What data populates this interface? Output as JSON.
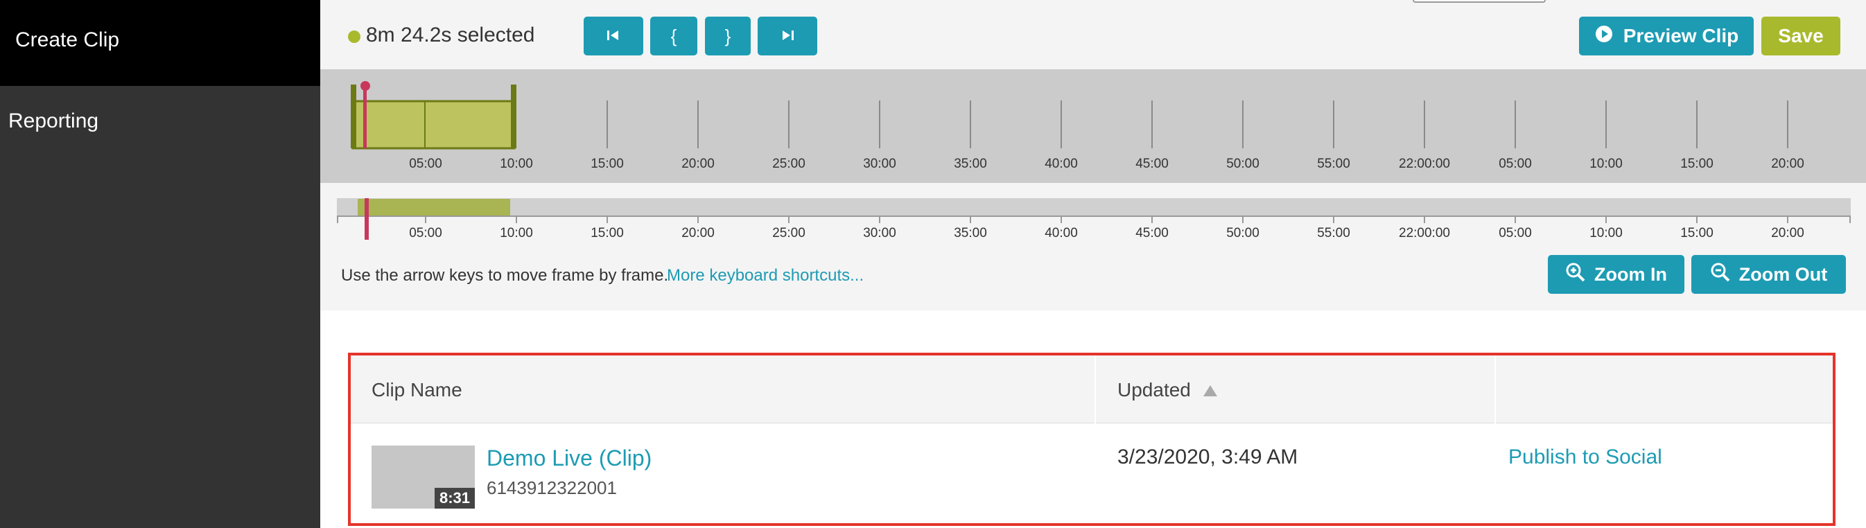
{
  "sidebar": {
    "items": [
      {
        "label": "Create Clip",
        "active": true
      },
      {
        "label": "Reporting",
        "active": false
      }
    ]
  },
  "toolbar": {
    "selection_text": "8m 24.2s selected",
    "buttons": [
      {
        "icon": "skip-to-start-icon",
        "glyph": "⏮"
      },
      {
        "icon": "set-in-point-icon",
        "glyph": "{"
      },
      {
        "icon": "set-out-point-icon",
        "glyph": "}"
      },
      {
        "icon": "skip-to-end-icon",
        "glyph": "⏭"
      }
    ],
    "preview_label": "Preview Clip",
    "save_label": "Save"
  },
  "timeline": {
    "tick_labels": [
      "05:00",
      "10:00",
      "15:00",
      "20:00",
      "25:00",
      "30:00",
      "35:00",
      "40:00",
      "45:00",
      "50:00",
      "55:00",
      "22:00:00",
      "05:00",
      "10:00",
      "15:00",
      "20:00"
    ]
  },
  "hint": {
    "text": "Use the arrow keys to move frame by frame.",
    "link": "More keyboard shortcuts..."
  },
  "zoom": {
    "in_label": "Zoom In",
    "out_label": "Zoom Out"
  },
  "table": {
    "columns": [
      "Clip Name",
      "Updated",
      ""
    ],
    "sort_column": "Updated",
    "rows": [
      {
        "name": "Demo Live (Clip)",
        "id": "6143912322001",
        "duration": "8:31",
        "updated": "3/23/2020, 3:49 AM",
        "action": "Publish to Social"
      }
    ]
  },
  "colors": {
    "accent": "#1d9bb3",
    "save": "#a9b92d",
    "selection": "#bcc35f",
    "playhead": "#c8375c",
    "highlight_border": "#e4342b"
  }
}
